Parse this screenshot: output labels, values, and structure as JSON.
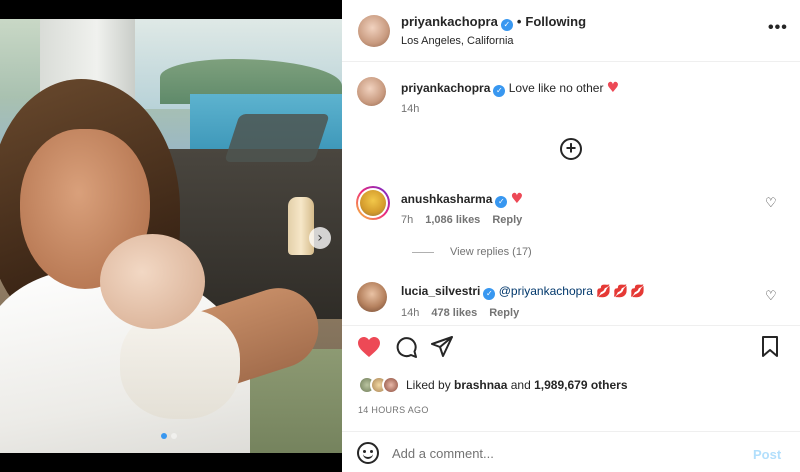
{
  "media": {
    "next_icon": "chevron-right-icon",
    "carousel_dots": 2,
    "carousel_active_index": 0
  },
  "header": {
    "username": "priyankachopra",
    "verified_icon": "verified-badge-icon",
    "separator": "•",
    "follow_status": "Following",
    "location": "Los Angeles, California",
    "more_icon": "more-horizontal-icon",
    "more_label": "•••"
  },
  "caption": {
    "username": "priyankachopra",
    "text": "Love like no other",
    "emoji": "♥",
    "time": "14h"
  },
  "load_more_icon": "plus-circle-icon",
  "load_more_label": "+",
  "comments": [
    {
      "username": "anushkasharma",
      "verified": true,
      "text": "",
      "emoji": "♥",
      "time": "7h",
      "likes": "1,086 likes",
      "reply": "Reply",
      "view_replies": "View replies (17)"
    },
    {
      "username": "lucia_silvestri",
      "verified": true,
      "mention": "@priyankachopra",
      "emoji": "💋💋💋",
      "time": "14h",
      "likes": "478 likes",
      "reply": "Reply"
    }
  ],
  "actions": {
    "like_icon": "heart-filled-icon",
    "comment_icon": "comment-icon",
    "share_icon": "share-icon",
    "save_icon": "bookmark-icon",
    "liked_by_prefix": "Liked by",
    "liked_by_user": "brashnaa",
    "liked_by_and": "and",
    "liked_by_count": "1,989,679 others",
    "time_ago": "14 HOURS AGO"
  },
  "add_comment": {
    "emoji_icon": "emoji-icon",
    "placeholder": "Add a comment...",
    "post_label": "Post"
  },
  "colors": {
    "verified_blue": "#3897f0",
    "like_red": "#ed4956",
    "post_disabled": "#b2dffc",
    "mention": "#00376b"
  }
}
